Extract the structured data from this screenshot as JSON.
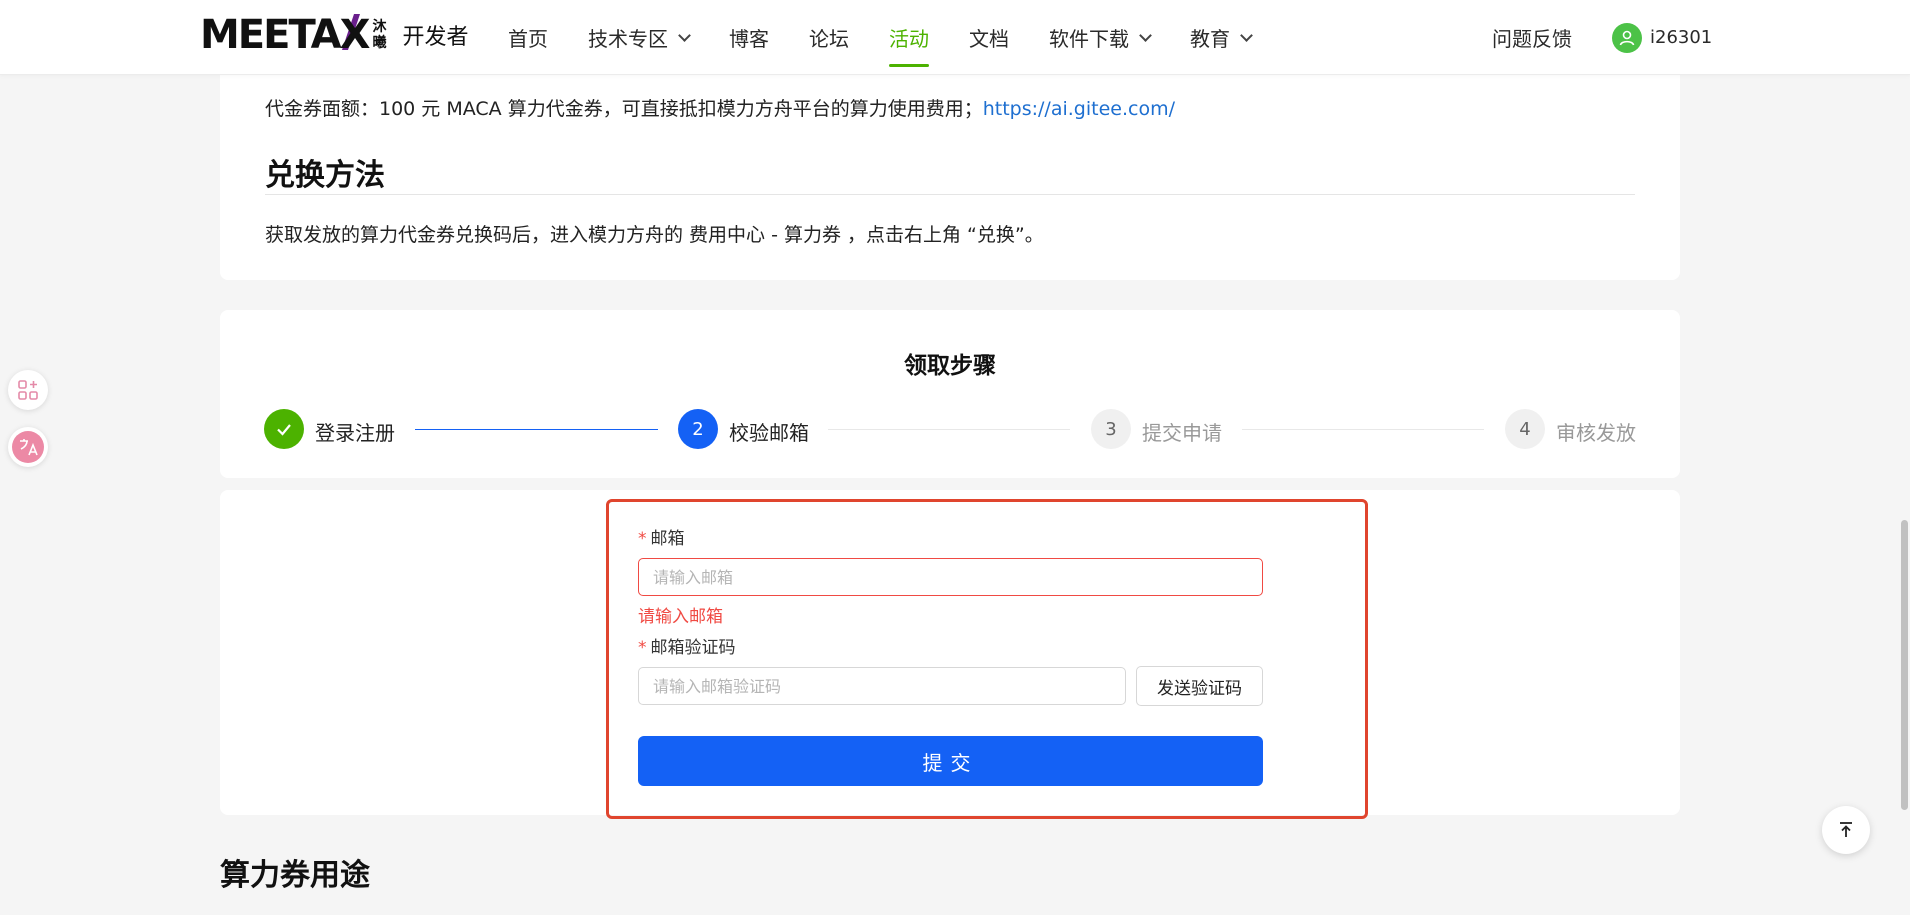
{
  "header": {
    "logo_main": "MEETAX",
    "logo_sub_1": "沐",
    "logo_sub_2": "曦",
    "logo_dev": "开发者",
    "nav": [
      {
        "label": "首页"
      },
      {
        "label": "技术专区",
        "dropdown": true
      },
      {
        "label": "博客"
      },
      {
        "label": "论坛"
      },
      {
        "label": "活动",
        "active": true
      },
      {
        "label": "文档"
      },
      {
        "label": "软件下载",
        "dropdown": true
      },
      {
        "label": "教育",
        "dropdown": true
      }
    ],
    "feedback": "问题反馈",
    "username": "i26301"
  },
  "info": {
    "voucher_text": "代金券面额：100 元 MACA 算力代金券，可直接抵扣模力方舟平台的算力使用费用；",
    "voucher_link": "https://ai.gitee.com/",
    "exchange_heading": "兑换方法",
    "exchange_desc": "获取发放的算力代金券兑换码后，进入模力方舟的 费用中心 - 算力券 ，点击右上角 “兑换”。"
  },
  "steps": {
    "title": "领取步骤",
    "items": [
      {
        "number": "1",
        "label": "登录注册",
        "status": "done"
      },
      {
        "number": "2",
        "label": "校验邮箱",
        "status": "current"
      },
      {
        "number": "3",
        "label": "提交申请",
        "status": "pending"
      },
      {
        "number": "4",
        "label": "审核发放",
        "status": "pending"
      }
    ]
  },
  "form": {
    "email_label": "邮箱",
    "email_placeholder": "请输入邮箱",
    "email_value": "",
    "email_error": "请输入邮箱",
    "code_label": "邮箱验证码",
    "code_placeholder": "请输入邮箱验证码",
    "code_value": "",
    "send_code_label": "发送验证码",
    "submit_label": "提交",
    "required_mark": "*"
  },
  "usage_heading": "算力券用途",
  "colors": {
    "accent_green": "#4cb200",
    "primary_blue": "#1461f5",
    "error_red": "#f04a43",
    "highlight_border": "#e0452e",
    "link_blue": "#1e6fd0"
  },
  "icons": {
    "step_done": "check-icon",
    "user": "user-icon",
    "back_to_top": "arrow-up-bar-icon",
    "apps": "apps-icon",
    "translate": "translate-icon"
  }
}
